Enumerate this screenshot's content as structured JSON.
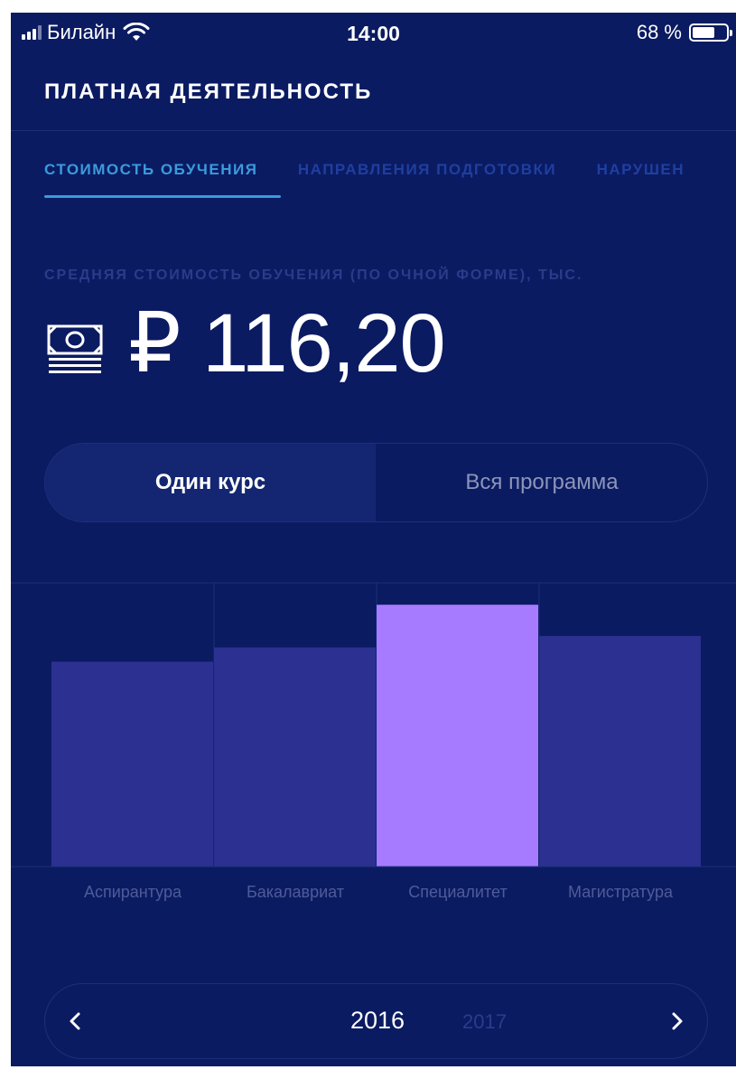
{
  "status_bar": {
    "carrier": "Билайн",
    "time": "14:00",
    "battery": "68 %",
    "battery_level": 0.68
  },
  "header": {
    "title": "ПЛАТНАЯ ДЕЯТЕЛЬНОСТЬ"
  },
  "tabs": [
    {
      "label": "СТОИМОСТЬ ОБУЧЕНИЯ",
      "active": true
    },
    {
      "label": "НАПРАВЛЕНИЯ ПОДГОТОВКИ",
      "active": false
    },
    {
      "label": "НАРУШЕН",
      "active": false
    }
  ],
  "metric": {
    "label": "СРЕДНЯЯ СТОИМОСТЬ ОБУЧЕНИЯ (ПО ОЧНОЙ ФОРМЕ), ТЫС.",
    "value": "₽ 116,20",
    "icon": "money-icon"
  },
  "segmented": {
    "options": [
      "Один курс",
      "Вся программа"
    ],
    "selected": "Один курс"
  },
  "chart_data": {
    "type": "bar",
    "categories": [
      "Аспирантура",
      "Бакалавриат",
      "Специалитет",
      "Магистратура"
    ],
    "values": [
      72,
      77,
      92,
      81
    ],
    "ylim": [
      0,
      100
    ],
    "highlighted": "Специалитет",
    "grid": true,
    "colors": {
      "bar": "#2c3191",
      "highlight": "#a77bff",
      "grid": "#1e2f7a",
      "label": "#4f5b98"
    }
  },
  "year_pager": {
    "current": "2016",
    "next": "2017"
  },
  "colors": {
    "background": "#0b1b62",
    "accent": "#3a9bdc",
    "inactive_tab": "#1f3fa0"
  }
}
